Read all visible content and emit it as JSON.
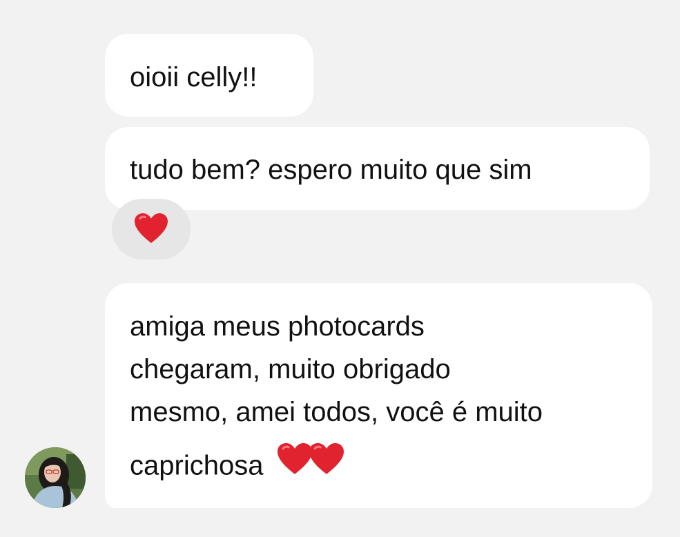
{
  "messages": [
    {
      "text": "oioii celly!!"
    },
    {
      "text": "tudo bem? espero muito que sim"
    },
    {
      "lines": [
        "amiga meus photocards",
        "chegaram, muito obrigado",
        "mesmo, amei todos, você é muito",
        "caprichosa"
      ],
      "trailing_emojis": [
        "red-heart",
        "red-heart"
      ]
    }
  ],
  "reaction": {
    "emoji": "red-heart"
  },
  "colors": {
    "background": "#f2f2f2",
    "bubble": "#ffffff",
    "reaction_bg": "#e6e6e6",
    "heart": "#e0232f",
    "text": "#111111"
  },
  "avatar": {
    "icon": "profile-photo"
  }
}
